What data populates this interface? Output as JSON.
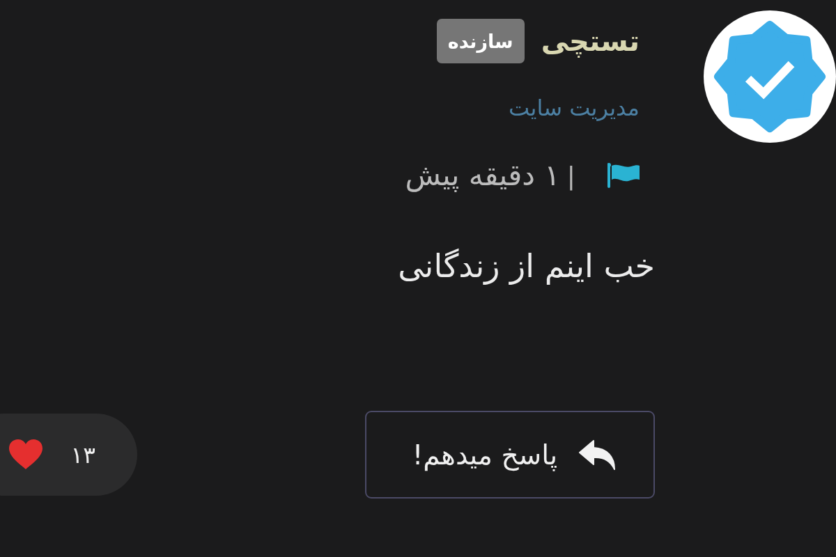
{
  "comment": {
    "author": {
      "name": "تستچی",
      "badge": "سازنده",
      "role": "مدیریت سایت"
    },
    "meta": {
      "separator": "|",
      "time": "۱ دقیقه پیش"
    },
    "text": "خب اینم از زندگانی",
    "reply_button": {
      "label": "پاسخ میدهم!"
    },
    "likes": {
      "count": "۱۳"
    }
  }
}
